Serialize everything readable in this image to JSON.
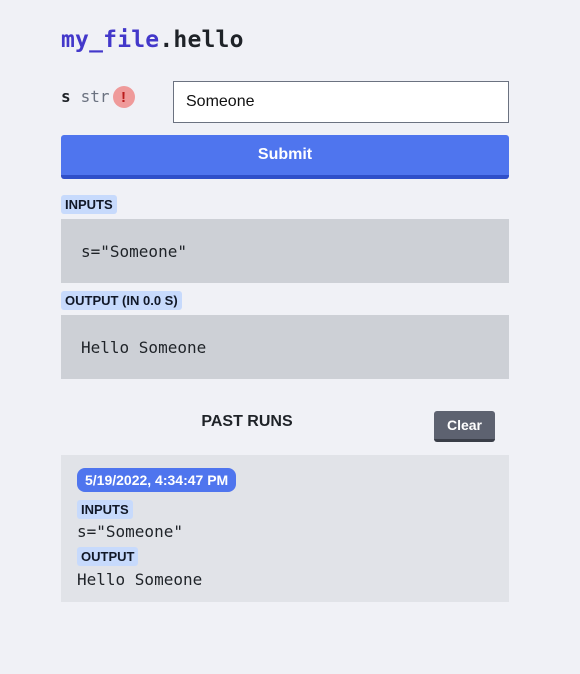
{
  "header": {
    "module": "my_file",
    "separator": ".",
    "function": "hello"
  },
  "form": {
    "param_name": "s",
    "param_type": "str",
    "warning_glyph": "!",
    "input_value": "Someone",
    "submit_label": "Submit"
  },
  "result": {
    "inputs_label": "INPUTS",
    "inputs_value": "s=\"Someone\"",
    "output_label": "OUTPUT (IN 0.0 S)",
    "output_value": "Hello Someone"
  },
  "past_runs": {
    "title": "PAST RUNS",
    "clear_label": "Clear",
    "runs": [
      {
        "timestamp": "5/19/2022, 4:34:47 PM",
        "inputs_label": "INPUTS",
        "inputs_value": "s=\"Someone\"",
        "output_label": "OUTPUT",
        "output_value": "Hello Someone"
      }
    ]
  },
  "colors": {
    "accent": "#4f75ee",
    "module_name": "#4338ca",
    "tag_bg": "#c7dafc",
    "warning": "#ef9a9a"
  }
}
